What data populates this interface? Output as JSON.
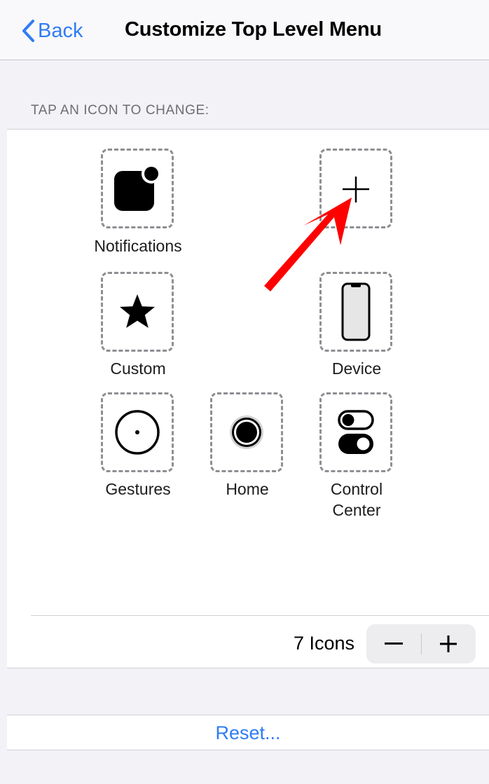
{
  "navbar": {
    "back_label": "Back",
    "title": "Customize Top Level Menu"
  },
  "section_header": "TAP AN ICON TO CHANGE:",
  "grid": {
    "slots": [
      {
        "label": "Notifications",
        "icon": "notifications-icon"
      },
      {
        "label": "",
        "icon": "add-plus-icon"
      },
      {
        "label": "Custom",
        "icon": "star-icon"
      },
      {
        "label": "Device",
        "icon": "iphone-device-icon"
      },
      {
        "label": "Gestures",
        "icon": "gestures-circle-icon"
      },
      {
        "label": "Home",
        "icon": "home-button-icon"
      },
      {
        "label_line1": "Control",
        "label_line2": "Center",
        "icon": "control-center-toggles-icon"
      }
    ]
  },
  "stepper": {
    "count_label": "7 Icons",
    "minus": "−",
    "plus": "+"
  },
  "reset_label": "Reset...",
  "colors": {
    "accent": "#2f7cf6",
    "annotation_arrow": "#ff0000",
    "background": "#f2f2f7"
  }
}
